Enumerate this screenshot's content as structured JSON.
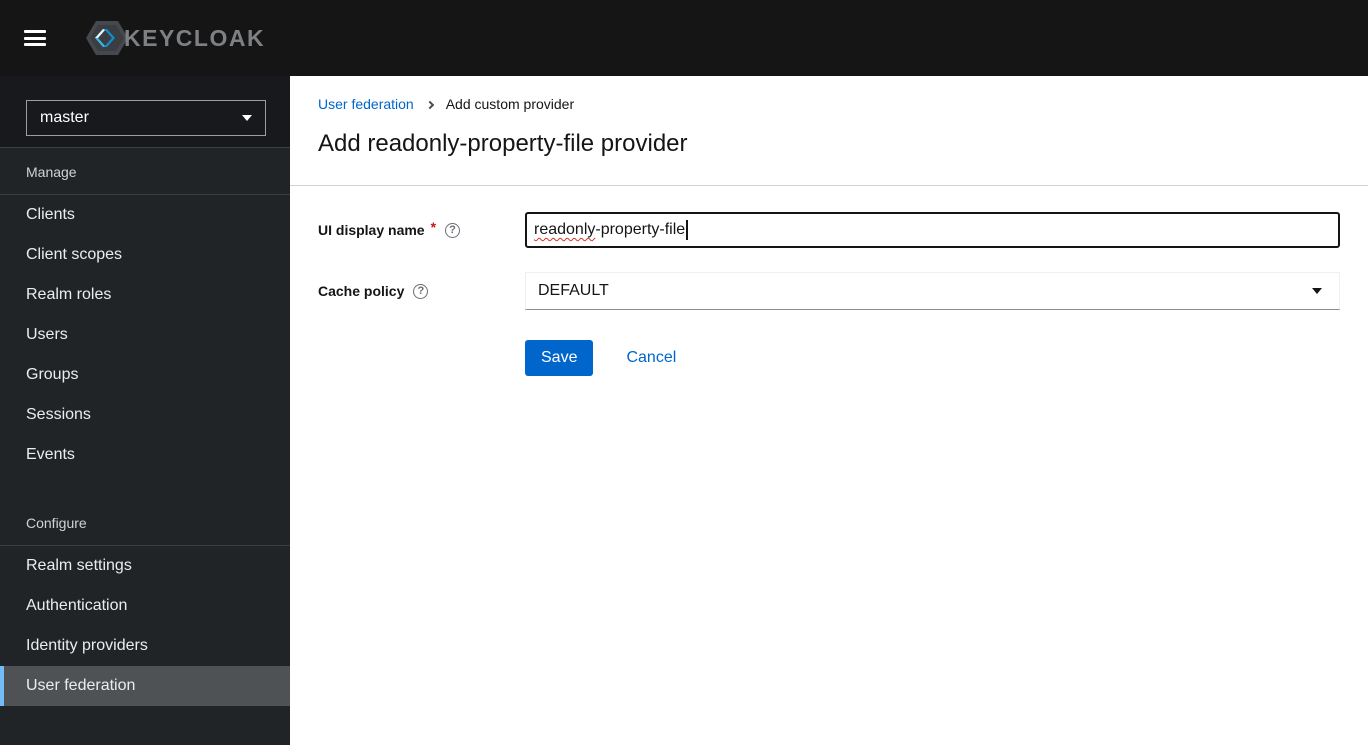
{
  "masthead": {
    "brand_text": "KEYCLOAK"
  },
  "sidebar": {
    "realm_selector": {
      "value": "master"
    },
    "sections": [
      {
        "title": "Manage",
        "items": [
          {
            "label": "Clients"
          },
          {
            "label": "Client scopes"
          },
          {
            "label": "Realm roles"
          },
          {
            "label": "Users"
          },
          {
            "label": "Groups"
          },
          {
            "label": "Sessions"
          },
          {
            "label": "Events"
          }
        ]
      },
      {
        "title": "Configure",
        "items": [
          {
            "label": "Realm settings"
          },
          {
            "label": "Authentication"
          },
          {
            "label": "Identity providers"
          },
          {
            "label": "User federation",
            "selected": true
          }
        ]
      }
    ]
  },
  "breadcrumb": {
    "link": "User federation",
    "current": "Add custom provider"
  },
  "page": {
    "title": "Add readonly-property-file provider"
  },
  "form": {
    "ui_display_name": {
      "label": "UI display name",
      "required_marker": "*",
      "value": "readonly-property-file",
      "value_misspelled": "readonly",
      "value_rest": "-property-file"
    },
    "cache_policy": {
      "label": "Cache policy",
      "value": "DEFAULT"
    },
    "actions": {
      "save": "Save",
      "cancel": "Cancel"
    }
  },
  "icons": {
    "help_glyph": "?",
    "hamburger": "hamburger-menu-icon",
    "realm_caret": "chevron-down-icon",
    "breadcrumb_separator": "angle-right-icon",
    "select_caret": "chevron-down-icon"
  },
  "colors": {
    "masthead_bg": "#151515",
    "sidebar_bg": "#212427",
    "realm_block_bg": "#17191d",
    "nav_selected_bg": "#4f5255",
    "nav_selected_accent": "#73bcf7",
    "primary": "#0066cc",
    "required_red": "#c9190b",
    "text_dark": "#151515",
    "divider": "#d2d2d2",
    "spellcheck_red": "#d93025"
  }
}
